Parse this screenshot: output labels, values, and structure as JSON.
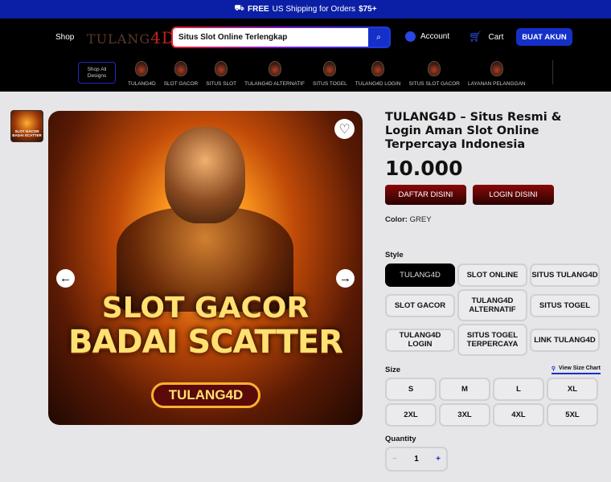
{
  "announcement": {
    "free": "FREE",
    "text": "US Shipping for Orders",
    "amount": "$75+"
  },
  "header": {
    "shop": "Shop",
    "logo_main": "TULANG",
    "logo_accent": "4D",
    "search_value": "Situs Slot Online Terlengkap",
    "search_icon": "⌕",
    "account": "Account",
    "cart": "Cart",
    "register": "BUAT AKUN"
  },
  "nav": {
    "shop_all": "Shop All Designs",
    "items": [
      "TULANG4D",
      "SLOT GACOR",
      "SITUS SLOT",
      "TULANG4D ALTERNATIF",
      "SITUS TOGEL",
      "TULANG4D LOGIN",
      "SITUS SLOT GACOR",
      "LAYANAN PELANGGAN"
    ]
  },
  "gallery": {
    "thumb_text": "SLOT GACOR BADAI SCATTER",
    "banner_line1": "SLOT GACOR",
    "banner_line2": "BADAI SCATTER",
    "banner_pill": "TULANG4D"
  },
  "product": {
    "title": "TULANG4D – Situs Resmi & Login Aman Slot Online Terpercaya Indonesia",
    "price": "10.000",
    "btn_daftar": "DAFTAR DISINI",
    "btn_login": "LOGIN DISINI",
    "color_label": "Color:",
    "color_value": "GREY",
    "style_label": "Style",
    "styles": [
      "TULANG4D",
      "SLOT ONLINE",
      "SITUS TULANG4D",
      "SLOT GACOR",
      "TULANG4D ALTERNATIF",
      "SITUS TOGEL",
      "TULANG4D LOGIN",
      "SITUS TOGEL TERPERCAYA",
      "LINK TULANG4D"
    ],
    "size_label": "Size",
    "size_chart": "View Size Chart",
    "sizes": [
      "S",
      "M",
      "L",
      "XL",
      "2XL",
      "3XL",
      "4XL",
      "5XL"
    ],
    "quantity_label": "Quantity",
    "quantity": "1",
    "minus": "−",
    "plus": "+"
  }
}
